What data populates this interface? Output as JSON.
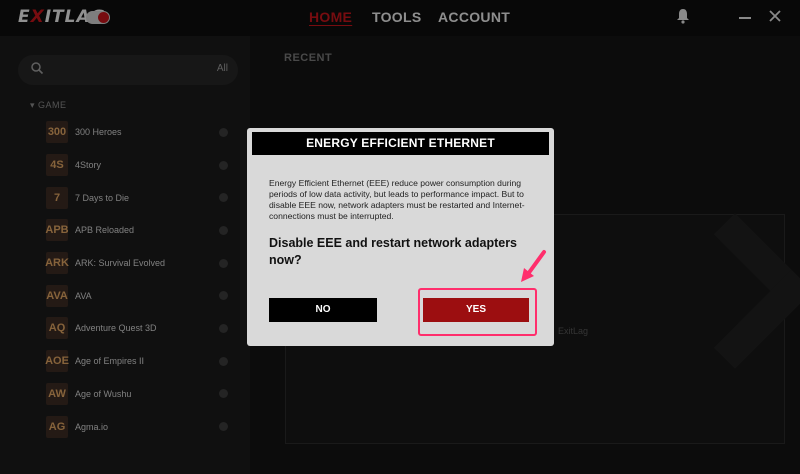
{
  "app": {
    "logo": "EXITLAG",
    "nav": {
      "home": "HOME",
      "tools": "TOOLS",
      "account": "ACCOUNT"
    },
    "icons": [
      "bell-icon",
      "minimize-icon",
      "close-icon"
    ]
  },
  "sidebar": {
    "search_placeholder": "",
    "filter_label": "All",
    "section_label": "GAME",
    "games": [
      {
        "name": "300 Heroes",
        "icon": "300"
      },
      {
        "name": "4Story",
        "icon": "4S"
      },
      {
        "name": "7 Days to Die",
        "icon": "7"
      },
      {
        "name": "APB Reloaded",
        "icon": "APB"
      },
      {
        "name": "ARK: Survival Evolved",
        "icon": "ARK"
      },
      {
        "name": "AVA",
        "icon": "AVA"
      },
      {
        "name": "Adventure Quest 3D",
        "icon": "AQ"
      },
      {
        "name": "Age of Empires II",
        "icon": "AOE"
      },
      {
        "name": "Age of Wushu",
        "icon": "AW"
      },
      {
        "name": "Agma.io",
        "icon": "AG"
      }
    ]
  },
  "main": {
    "recent_label": "RECENT",
    "ghost_text": "ExitLag"
  },
  "modal": {
    "title": "ENERGY EFFICIENT ETHERNET",
    "body": "Energy Efficient Ethernet (EEE) reduce power consumption during periods of low data activity, but leads to performance impact. But to disable EEE now, network adapters must be restarted and Internet-connections must be interrupted.",
    "question": "Disable EEE and restart network adapters now?",
    "no_label": "NO",
    "yes_label": "YES"
  },
  "colors": {
    "accent": "#c0141a",
    "highlight": "#ff2e6c",
    "yes_button": "#9c0e10"
  }
}
